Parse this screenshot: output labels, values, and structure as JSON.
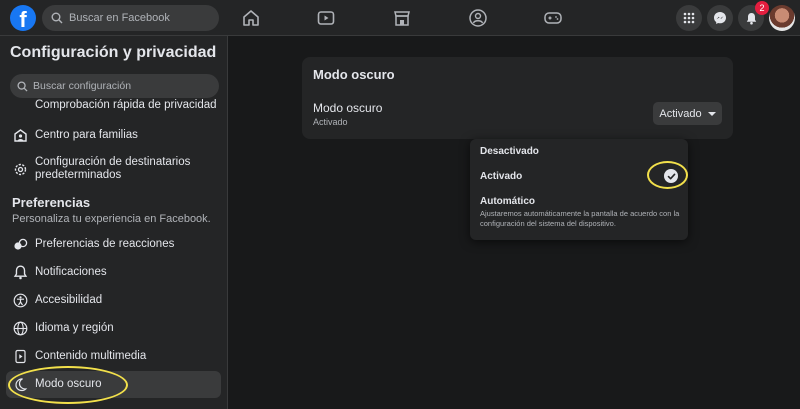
{
  "topbar": {
    "logo": "f",
    "search_placeholder": "Buscar en Facebook",
    "nav_icons": [
      "home-icon",
      "watch-icon",
      "marketplace-icon",
      "groups-icon",
      "gaming-icon"
    ],
    "right_icons": [
      "menu-grid-icon",
      "messenger-icon",
      "notifications-icon"
    ],
    "notification_count": "2"
  },
  "sidebar": {
    "title": "Configuración y privacidad",
    "search_placeholder": "Buscar configuración",
    "items_top": [
      {
        "label": "Comprobación rápida de privacidad",
        "icon": "lock-icon"
      },
      {
        "label": "Centro para familias",
        "icon": "family-icon"
      },
      {
        "label": "Configuración de destinatarios predeterminados",
        "icon": "gear-icon"
      }
    ],
    "section_title": "Preferencias",
    "section_subtitle": "Personaliza tu experiencia en Facebook.",
    "items": [
      {
        "label": "Preferencias de reacciones",
        "icon": "reactions-icon"
      },
      {
        "label": "Notificaciones",
        "icon": "bell-icon"
      },
      {
        "label": "Accesibilidad",
        "icon": "accessibility-icon"
      },
      {
        "label": "Idioma y región",
        "icon": "globe-icon"
      },
      {
        "label": "Contenido multimedia",
        "icon": "media-icon"
      },
      {
        "label": "Modo oscuro",
        "icon": "moon-icon"
      }
    ]
  },
  "main": {
    "card_title": "Modo oscuro",
    "setting_title": "Modo oscuro",
    "setting_value": "Activado",
    "dropdown_value": "Activado",
    "menu": {
      "options": [
        "Desactivado",
        "Activado",
        "Automático"
      ],
      "selected": "Activado",
      "auto_description": "Ajustaremos automáticamente la pantalla de acuerdo con la configuración del sistema del dispositivo."
    }
  },
  "colors": {
    "background": "#18191a",
    "surface": "#242526",
    "accent": "#1877f2",
    "highlight": "#f2e04b",
    "badge": "#e41e3f"
  }
}
